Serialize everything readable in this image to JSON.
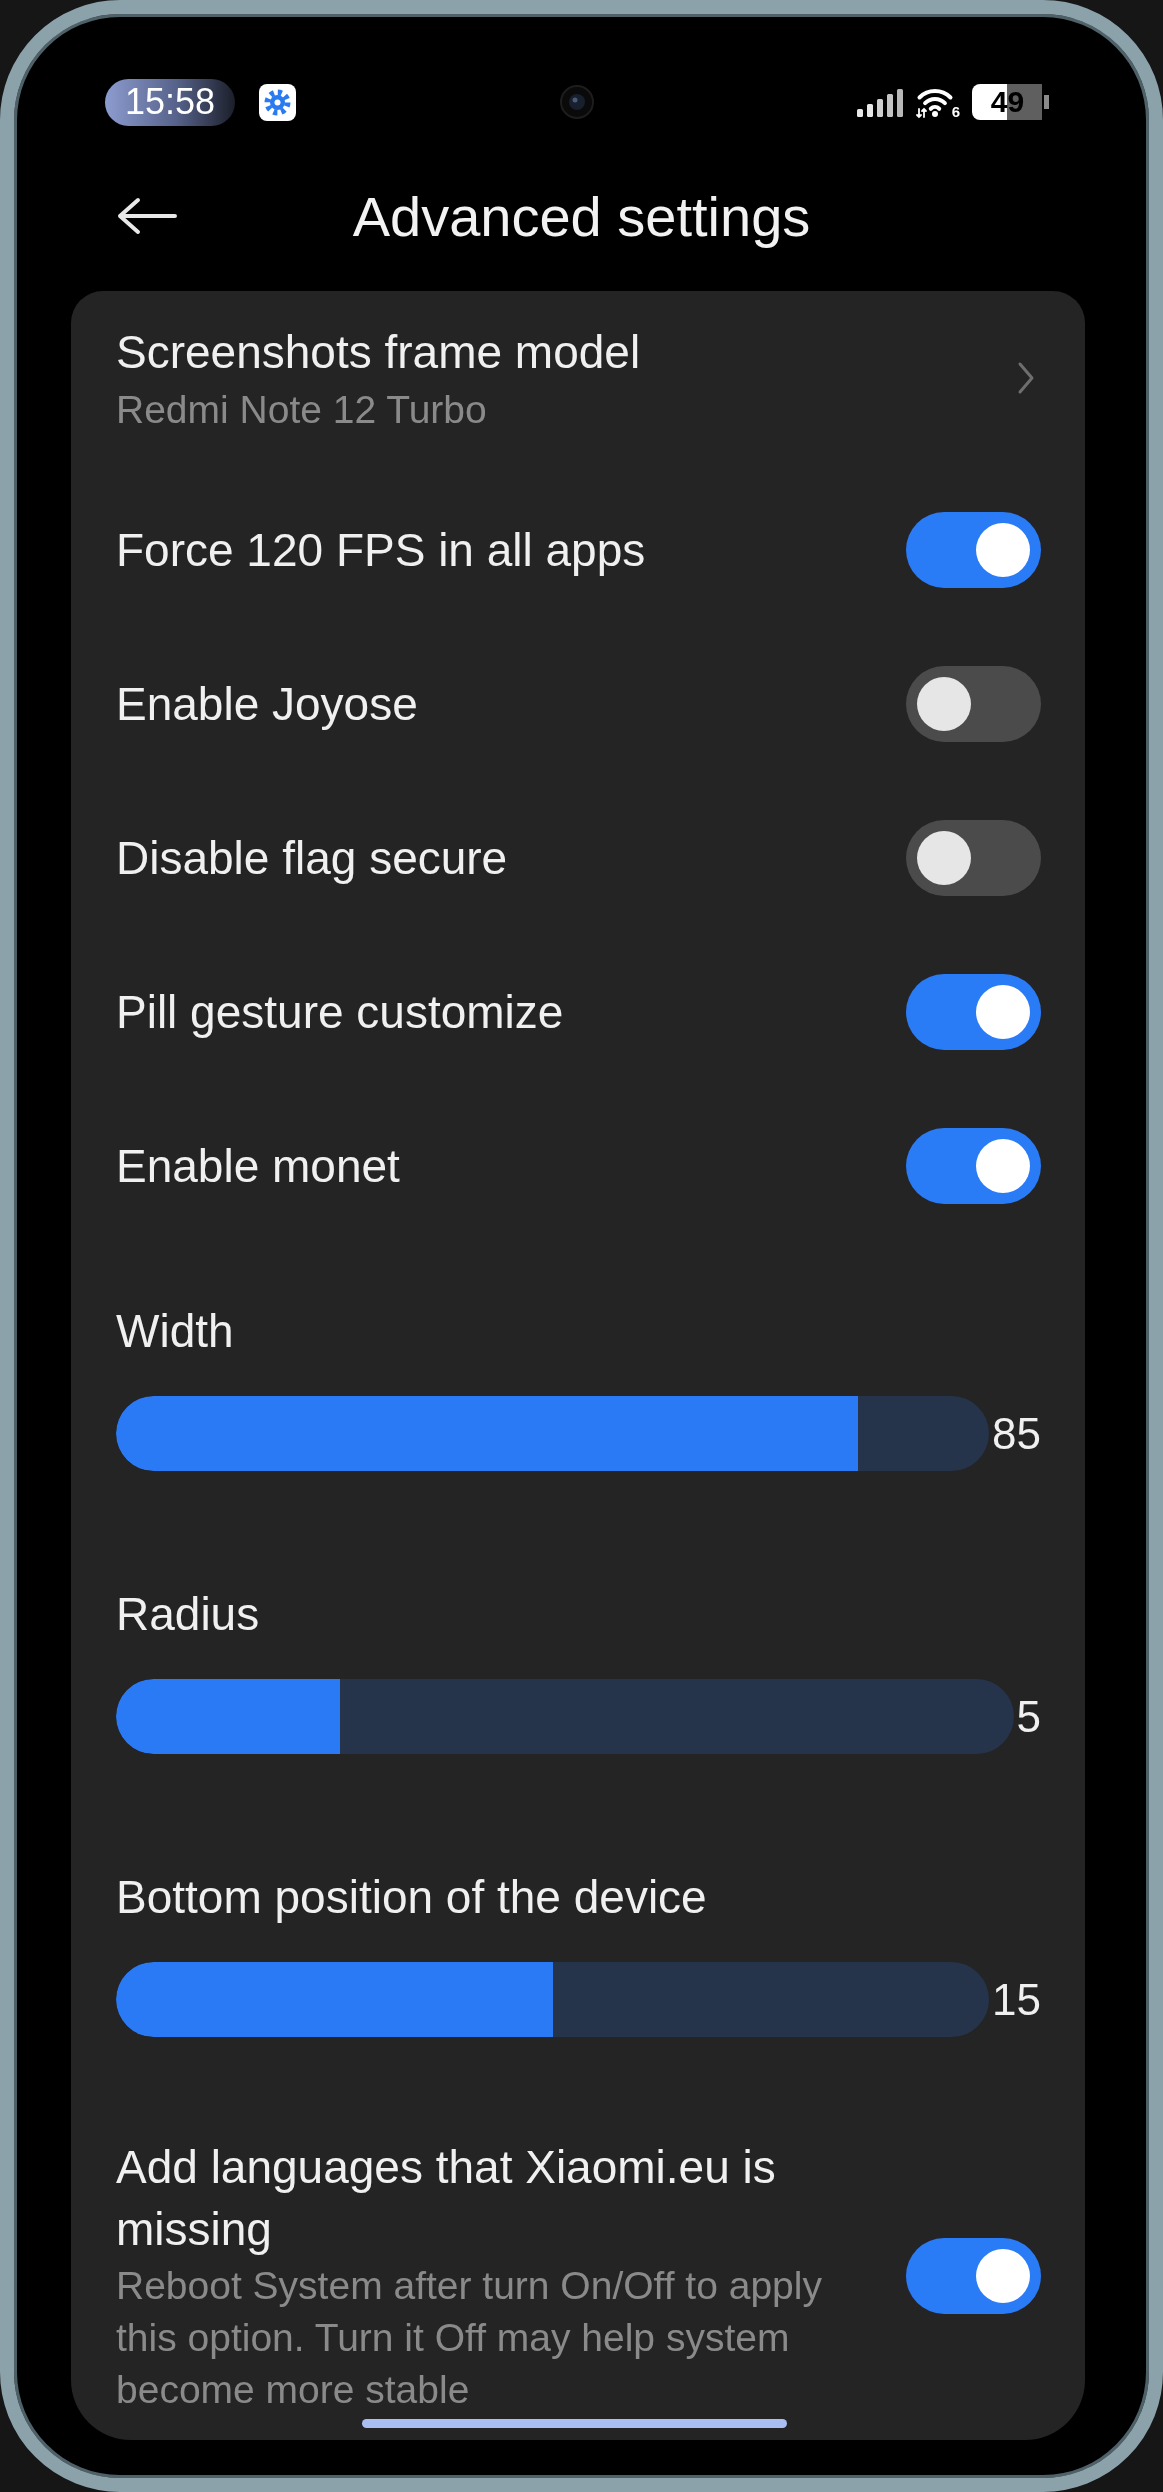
{
  "status_bar": {
    "time": "15:58",
    "wifi_badge": "6",
    "battery": "49"
  },
  "header": {
    "title": "Advanced settings"
  },
  "settings": [
    {
      "kind": "link",
      "title": "Screenshots frame model",
      "subtitle": "Redmi Note 12 Turbo"
    },
    {
      "kind": "switch",
      "title": "Force 120 FPS in all apps",
      "on": true
    },
    {
      "kind": "switch",
      "title": "Enable Joyose",
      "on": false
    },
    {
      "kind": "switch",
      "title": "Disable flag secure",
      "on": false
    },
    {
      "kind": "switch",
      "title": "Pill gesture customize",
      "on": true
    },
    {
      "kind": "switch",
      "title": "Enable monet",
      "on": true
    },
    {
      "kind": "slider",
      "title": "Width",
      "level": 0.85,
      "reading": "85"
    },
    {
      "kind": "slider",
      "title": "Radius",
      "level": 0.25,
      "reading": "5"
    },
    {
      "kind": "slider",
      "title": "Bottom position of the device",
      "level": 0.5,
      "reading": "15"
    },
    {
      "kind": "switch",
      "title": "Add languages that Xiaomi.eu is missing",
      "subtitle": "Reboot System after turn On/Off to apply this option. Turn it Off may help system become more stable",
      "on": true
    }
  ]
}
